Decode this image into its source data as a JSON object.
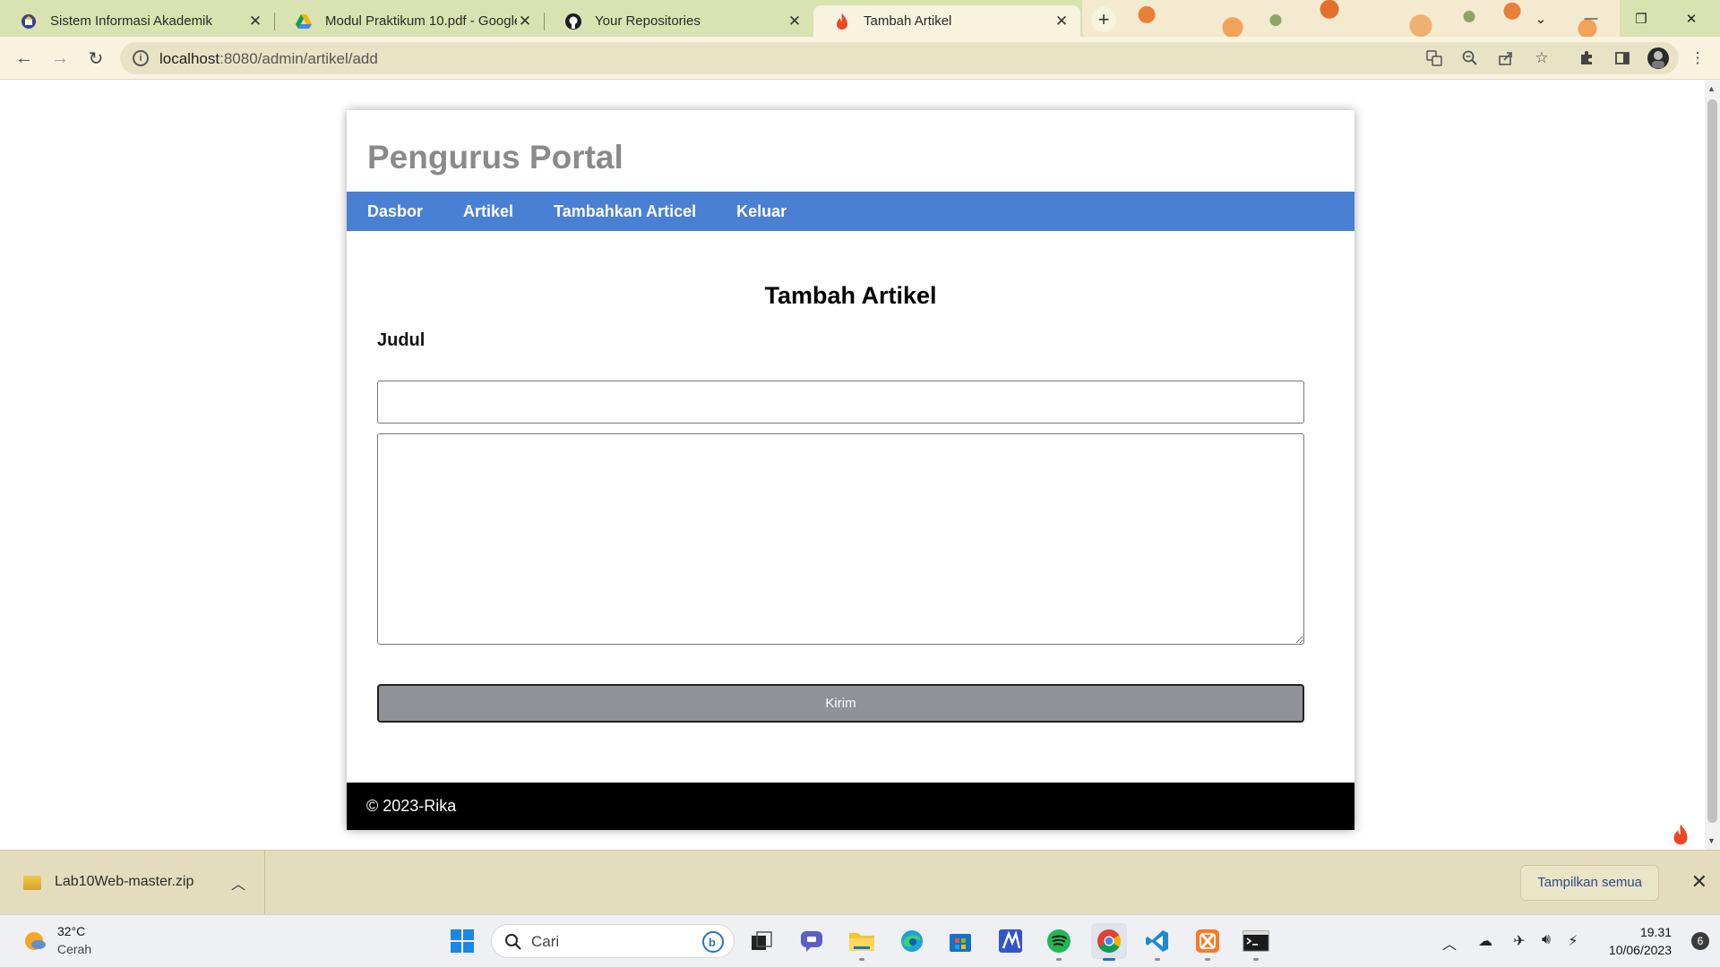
{
  "browser": {
    "tabs": [
      {
        "title": "Sistem Informasi Akademik",
        "icon": "university-icon"
      },
      {
        "title": "Modul Praktikum 10.pdf - Google Drive",
        "icon": "google-drive-icon"
      },
      {
        "title": "Your Repositories",
        "icon": "github-icon"
      },
      {
        "title": "Tambah Artikel",
        "icon": "codeigniter-flame-icon",
        "active": true
      }
    ],
    "url_host": "localhost",
    "url_path": ":8080/admin/artikel/add"
  },
  "page": {
    "site_title": "Pengurus Portal",
    "nav": [
      "Dasbor",
      "Artikel",
      "Tambahkan Articel",
      "Keluar"
    ],
    "heading": "Tambah Artikel",
    "title_label": "Judul",
    "title_value": "",
    "content_value": "",
    "submit_label": "Kirim",
    "footer": "© 2023-Rika"
  },
  "downloads": {
    "file_name": "Lab10Web-master.zip",
    "show_all": "Tampilkan semua"
  },
  "taskbar": {
    "temperature": "32°C",
    "condition": "Cerah",
    "search_placeholder": "Cari",
    "time": "19.31",
    "date": "10/06/2023",
    "notifications": "6"
  },
  "colors": {
    "nav_bar": "#4a80d4",
    "site_title": "#8a8a8a",
    "submit_button": "#909297",
    "footer": "#000000",
    "tab_strip": "#d9e2b1",
    "toolbar": "#f7f3df"
  }
}
